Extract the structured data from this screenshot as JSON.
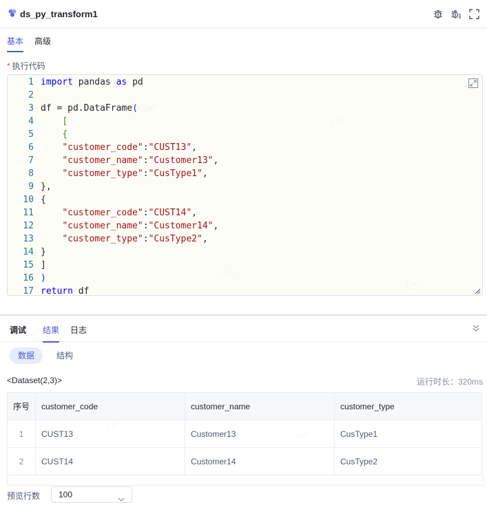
{
  "header": {
    "title": "ds_py_transform1",
    "icons": [
      "nodes-icon",
      "bug-icon",
      "bug-settings-icon",
      "fullscreen-icon"
    ]
  },
  "config_tabs": [
    {
      "label": "基本",
      "active": true
    },
    {
      "label": "高级",
      "active": false
    }
  ],
  "code_field": {
    "required_mark": "*",
    "label": "执行代码",
    "lines": [
      {
        "n": "1",
        "text": "import pandas as pd"
      },
      {
        "n": "2",
        "text": ""
      },
      {
        "n": "3",
        "text": "df = pd.DataFrame("
      },
      {
        "n": "4",
        "text": "    ["
      },
      {
        "n": "5",
        "text": "    {"
      },
      {
        "n": "6",
        "text": "    \"customer_code\":\"CUST13\","
      },
      {
        "n": "7",
        "text": "    \"customer_name\":\"Customer13\","
      },
      {
        "n": "8",
        "text": "    \"customer_type\":\"CusType1\","
      },
      {
        "n": "9",
        "text": "},"
      },
      {
        "n": "10",
        "text": "{"
      },
      {
        "n": "11",
        "text": "    \"customer_code\":\"CUST14\","
      },
      {
        "n": "12",
        "text": "    \"customer_name\":\"Customer14\","
      },
      {
        "n": "13",
        "text": "    \"customer_type\":\"CusType2\","
      },
      {
        "n": "14",
        "text": "}"
      },
      {
        "n": "15",
        "text": "]"
      },
      {
        "n": "16",
        "text": ")"
      },
      {
        "n": "17",
        "text": "return df"
      }
    ]
  },
  "debug": {
    "label": "调试",
    "tabs": [
      {
        "label": "结果",
        "active": true
      },
      {
        "label": "日志",
        "active": false
      }
    ],
    "sub_tabs": [
      {
        "label": "数据",
        "active": true
      },
      {
        "label": "结构",
        "active": false
      }
    ],
    "dataset_label": "<Dataset(2,3)>",
    "runtime": "运行时长：320ms"
  },
  "table": {
    "headers": [
      "序号",
      "customer_code",
      "customer_name",
      "customer_type"
    ],
    "rows": [
      [
        "1",
        "CUST13",
        "Customer13",
        "CusType1"
      ],
      [
        "2",
        "CUST14",
        "Customer14",
        "CusType2"
      ]
    ]
  },
  "preview": {
    "label": "预览行数",
    "value": "100"
  },
  "watermark": "Cars",
  "colors": {
    "accent": "#4a5bd4",
    "keyword": "#0000ff",
    "string": "#a31515",
    "line_number": "#237893"
  }
}
